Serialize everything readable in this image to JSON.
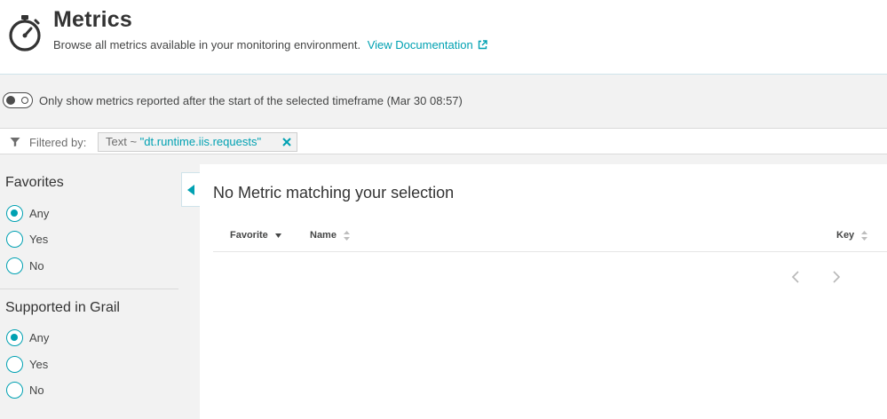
{
  "header": {
    "title": "Metrics",
    "subtitle": "Browse all metrics available in your monitoring environment.",
    "doc_link": "View Documentation",
    "icon": "stopwatch-icon"
  },
  "toggle": {
    "label": "Only show metrics reported after the start of the selected timeframe (Mar 30 08:57)",
    "enabled": false
  },
  "filter": {
    "label": "Filtered by:",
    "chip_key": "Text ~ ",
    "chip_value": "\"dt.runtime.iis.requests\""
  },
  "sidebar": {
    "favorites": {
      "title": "Favorites",
      "options": [
        "Any",
        "Yes",
        "No"
      ],
      "selected": "Any"
    },
    "grail": {
      "title": "Supported in Grail",
      "options": [
        "Any",
        "Yes",
        "No"
      ],
      "selected": "Any"
    }
  },
  "main": {
    "empty_title": "No Metric matching your selection",
    "columns": {
      "favorite": "Favorite",
      "name": "Name",
      "key": "Key"
    }
  },
  "colors": {
    "accent": "#00a1b2",
    "text": "#333333",
    "background": "#f2f2f2"
  }
}
